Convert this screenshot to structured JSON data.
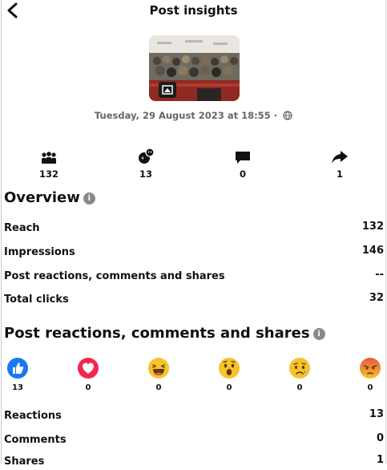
{
  "header": {
    "title": "Post insights"
  },
  "post": {
    "date": "Tuesday, 29 August 2023 at 18:55 ·"
  },
  "stats": [
    {
      "icon": "crowd-icon",
      "value": "132"
    },
    {
      "icon": "reactions-icon",
      "value": "13"
    },
    {
      "icon": "comment-icon",
      "value": "0"
    },
    {
      "icon": "share-icon",
      "value": "1"
    }
  ],
  "overview": {
    "title": "Overview",
    "rows": [
      {
        "label": "Reach",
        "value": "132"
      },
      {
        "label": "Impressions",
        "value": "146"
      },
      {
        "label": "Post reactions, comments and shares",
        "value": "--"
      },
      {
        "label": "Total clicks",
        "value": "32"
      }
    ]
  },
  "engagement": {
    "title": "Post reactions, comments and shares",
    "reactions": [
      {
        "name": "like",
        "count": "13"
      },
      {
        "name": "love",
        "count": "0"
      },
      {
        "name": "haha",
        "count": "0"
      },
      {
        "name": "wow",
        "count": "0"
      },
      {
        "name": "sad",
        "count": "0"
      },
      {
        "name": "angry",
        "count": "0"
      }
    ],
    "rows": [
      {
        "label": "Reactions",
        "value": "13"
      },
      {
        "label": "Comments",
        "value": "0"
      },
      {
        "label": "Shares",
        "value": "1"
      }
    ]
  },
  "colors": {
    "like": "#1877f2",
    "love": "#f0284a",
    "emoji": "#f7c22c",
    "angry": "#e9573f"
  }
}
